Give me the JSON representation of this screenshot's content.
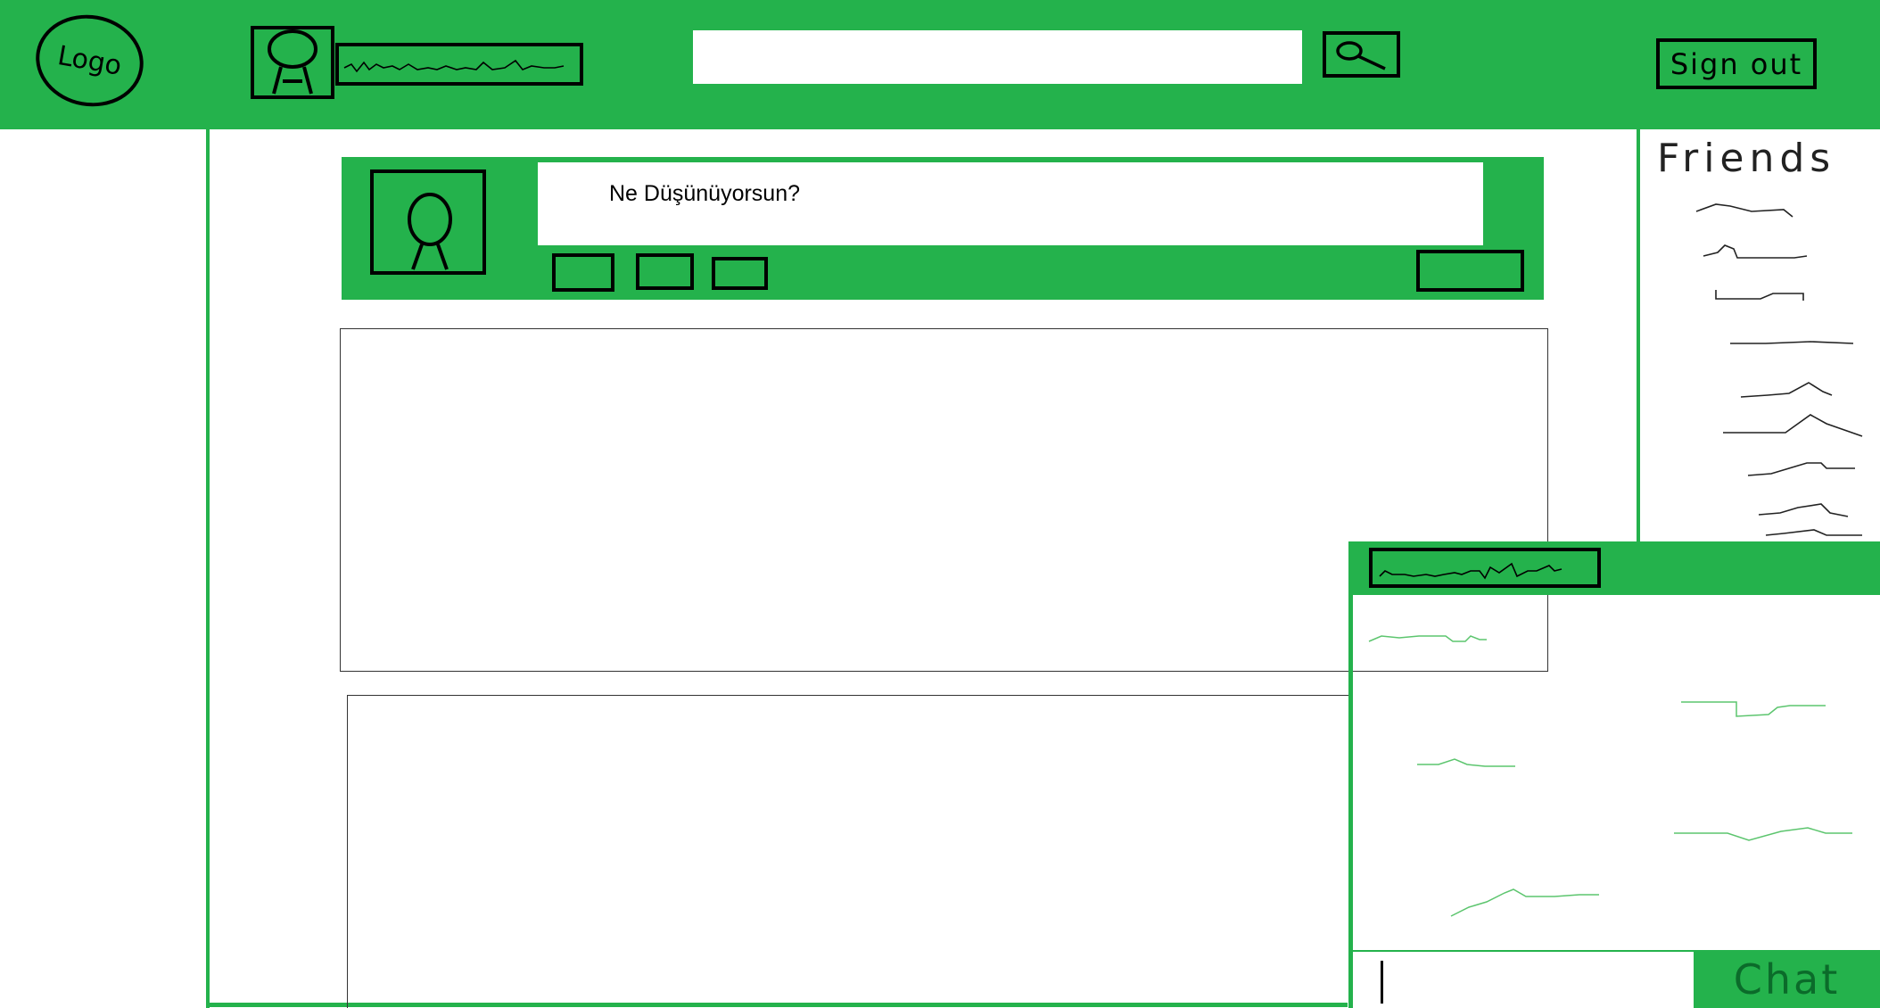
{
  "header": {
    "logo_text": "Logo",
    "signout_label": "Sign out",
    "search_placeholder": "",
    "search_icon": "search-icon"
  },
  "composer": {
    "placeholder": "Ne Düşünüyorsun?"
  },
  "friends": {
    "title": "Friends"
  },
  "chat": {
    "send_label": "Chat",
    "input_value": ""
  },
  "colors": {
    "accent": "#24b24c",
    "outline": "#000000",
    "background": "#ffffff"
  }
}
